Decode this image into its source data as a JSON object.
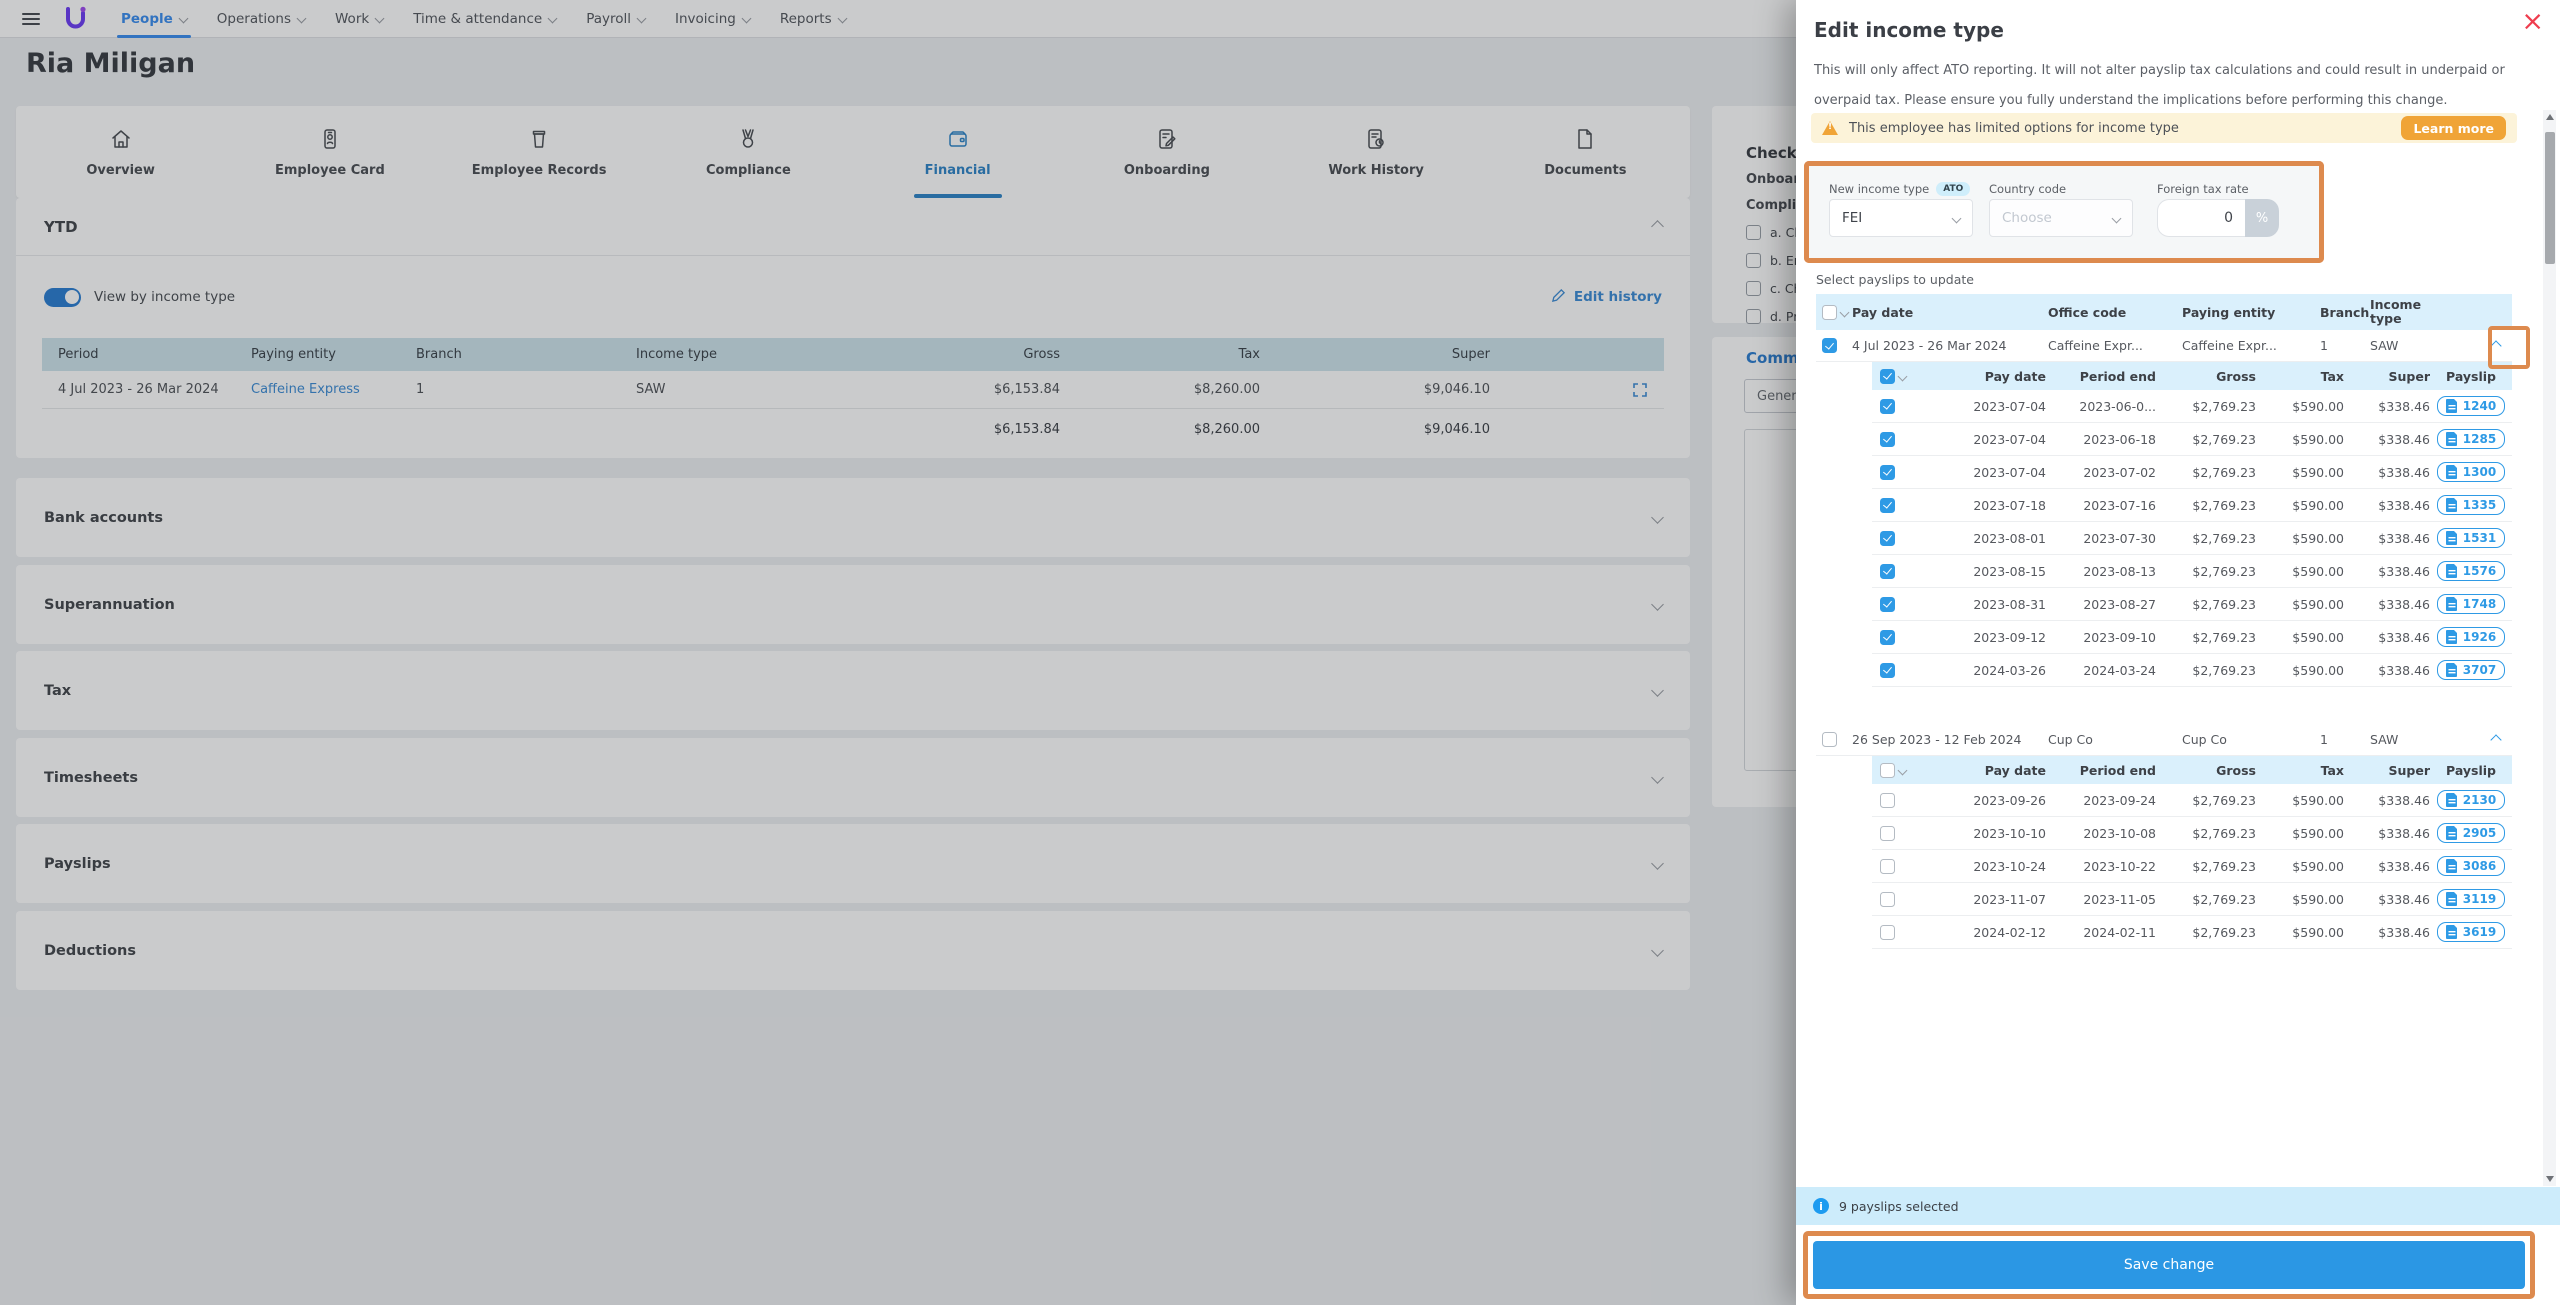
{
  "colors": {
    "accent_blue": "#2e9ae5",
    "nav_blue": "#3d8ff0",
    "link_blue": "#3f8ed6",
    "tab_active_blue": "#3186c8",
    "annotation_orange": "#dd8a4e",
    "warning_bg": "#fcf3d9",
    "warning_button_orange": "#f0a437",
    "danger_red": "#ef3d4e",
    "info_bar_blue": "#cdecfb",
    "table_header_blue": "#daf0fc",
    "ytd_header_teal": "#cfe4ec",
    "save_blue": "#2b97e4",
    "toggle_blue": "#2d7fd3",
    "logo_purple": "#6f3ff5"
  },
  "icons": {
    "close": "×",
    "menu": "hamburger",
    "warning": "triangle-exclamation",
    "info": "i"
  },
  "nav": {
    "items": [
      {
        "label": "People",
        "active": true
      },
      {
        "label": "Operations",
        "active": false
      },
      {
        "label": "Work",
        "active": false
      },
      {
        "label": "Time & attendance",
        "active": false
      },
      {
        "label": "Payroll",
        "active": false
      },
      {
        "label": "Invoicing",
        "active": false
      },
      {
        "label": "Reports",
        "active": false
      }
    ]
  },
  "page": {
    "title": "Ria Miligan"
  },
  "tabs": [
    {
      "label": "Overview",
      "icon": "home",
      "active": false
    },
    {
      "label": "Employee Card",
      "icon": "card",
      "active": false
    },
    {
      "label": "Employee Records",
      "icon": "records",
      "active": false
    },
    {
      "label": "Compliance",
      "icon": "medal",
      "active": false
    },
    {
      "label": "Financial",
      "icon": "wallet",
      "active": true
    },
    {
      "label": "Onboarding",
      "icon": "onboard",
      "active": false
    },
    {
      "label": "Work History",
      "icon": "history",
      "active": false
    },
    {
      "label": "Documents",
      "icon": "doc",
      "active": false
    }
  ],
  "ytd": {
    "title": "YTD",
    "toggle_label": "View by income type",
    "toggle_on": true,
    "edit_history": "Edit history",
    "table": {
      "headers": [
        "Period",
        "Paying entity",
        "Branch",
        "Income type",
        "Gross",
        "Tax",
        "Super"
      ],
      "row": {
        "period": "4 Jul 2023 - 26 Mar 2024",
        "paying_entity": "Caffeine Express",
        "branch": "1",
        "income_type": "SAW",
        "gross": "$6,153.84",
        "tax": "$8,260.00",
        "super": "$9,046.10"
      },
      "totals": {
        "gross": "$6,153.84",
        "tax": "$8,260.00",
        "super": "$9,046.10"
      }
    }
  },
  "accordions": [
    "Bank accounts",
    "Superannuation",
    "Tax",
    "Timesheets",
    "Payslips",
    "Deductions"
  ],
  "checklist": {
    "title": "Checkl",
    "section1": "Onboard",
    "section2": "Complia",
    "items": [
      "a. Che",
      "b. Emp",
      "c. Che",
      "d. Prol"
    ],
    "comments_title": "Comm",
    "comments_select": "Gener"
  },
  "drawer": {
    "title": "Edit income type",
    "description": "This will only affect ATO reporting. It will not alter payslip tax calculations and could result in underpaid or overpaid tax. Please ensure you fully understand the implications before performing this change.",
    "warning": {
      "text": "This employee has limited options for income type",
      "button": "Learn more"
    },
    "form": {
      "income_type_label": "New income type",
      "ato_badge": "ATO",
      "income_type_value": "FEI",
      "country_label": "Country code",
      "country_placeholder": "Choose",
      "tax_rate_label": "Foreign tax rate",
      "tax_rate_value": "0",
      "tax_rate_suffix": "%"
    },
    "select_label": "Select payslips to update",
    "table": {
      "outer_headers": [
        "Pay date",
        "Office code",
        "Paying entity",
        "Branch",
        "Income type"
      ],
      "inner_headers": [
        "Pay date",
        "Period end",
        "Gross",
        "Tax",
        "Super",
        "Payslip"
      ],
      "groups": [
        {
          "checked": true,
          "header_checked": true,
          "expanded": true,
          "pay_date": "4 Jul 2023 - 26 Mar 2024",
          "office_code": "Caffeine Expr...",
          "paying_entity": "Caffeine Expr...",
          "branch": "1",
          "income_type": "SAW",
          "rows": [
            {
              "checked": true,
              "pay_date": "2023-07-04",
              "period_end": "2023-06-0...",
              "gross": "$2,769.23",
              "tax": "$590.00",
              "super": "$338.46",
              "payslip": "1240"
            },
            {
              "checked": true,
              "pay_date": "2023-07-04",
              "period_end": "2023-06-18",
              "gross": "$2,769.23",
              "tax": "$590.00",
              "super": "$338.46",
              "payslip": "1285"
            },
            {
              "checked": true,
              "pay_date": "2023-07-04",
              "period_end": "2023-07-02",
              "gross": "$2,769.23",
              "tax": "$590.00",
              "super": "$338.46",
              "payslip": "1300"
            },
            {
              "checked": true,
              "pay_date": "2023-07-18",
              "period_end": "2023-07-16",
              "gross": "$2,769.23",
              "tax": "$590.00",
              "super": "$338.46",
              "payslip": "1335"
            },
            {
              "checked": true,
              "pay_date": "2023-08-01",
              "period_end": "2023-07-30",
              "gross": "$2,769.23",
              "tax": "$590.00",
              "super": "$338.46",
              "payslip": "1531"
            },
            {
              "checked": true,
              "pay_date": "2023-08-15",
              "period_end": "2023-08-13",
              "gross": "$2,769.23",
              "tax": "$590.00",
              "super": "$338.46",
              "payslip": "1576"
            },
            {
              "checked": true,
              "pay_date": "2023-08-31",
              "period_end": "2023-08-27",
              "gross": "$2,769.23",
              "tax": "$590.00",
              "super": "$338.46",
              "payslip": "1748"
            },
            {
              "checked": true,
              "pay_date": "2023-09-12",
              "period_end": "2023-09-10",
              "gross": "$2,769.23",
              "tax": "$590.00",
              "super": "$338.46",
              "payslip": "1926"
            },
            {
              "checked": true,
              "pay_date": "2024-03-26",
              "period_end": "2024-03-24",
              "gross": "$2,769.23",
              "tax": "$590.00",
              "super": "$338.46",
              "payslip": "3707"
            }
          ]
        },
        {
          "checked": false,
          "header_checked": false,
          "expanded": true,
          "pay_date": "26 Sep 2023 - 12 Feb 2024",
          "office_code": "Cup Co",
          "paying_entity": "Cup Co",
          "branch": "1",
          "income_type": "SAW",
          "rows": [
            {
              "checked": false,
              "pay_date": "2023-09-26",
              "period_end": "2023-09-24",
              "gross": "$2,769.23",
              "tax": "$590.00",
              "super": "$338.46",
              "payslip": "2130"
            },
            {
              "checked": false,
              "pay_date": "2023-10-10",
              "period_end": "2023-10-08",
              "gross": "$2,769.23",
              "tax": "$590.00",
              "super": "$338.46",
              "payslip": "2905"
            },
            {
              "checked": false,
              "pay_date": "2023-10-24",
              "period_end": "2023-10-22",
              "gross": "$2,769.23",
              "tax": "$590.00",
              "super": "$338.46",
              "payslip": "3086"
            },
            {
              "checked": false,
              "pay_date": "2023-11-07",
              "period_end": "2023-11-05",
              "gross": "$2,769.23",
              "tax": "$590.00",
              "super": "$338.46",
              "payslip": "3119"
            },
            {
              "checked": false,
              "pay_date": "2024-02-12",
              "period_end": "2024-02-11",
              "gross": "$2,769.23",
              "tax": "$590.00",
              "super": "$338.46",
              "payslip": "3619"
            }
          ]
        }
      ]
    },
    "footer": {
      "info": "9 payslips selected",
      "save": "Save change"
    }
  }
}
